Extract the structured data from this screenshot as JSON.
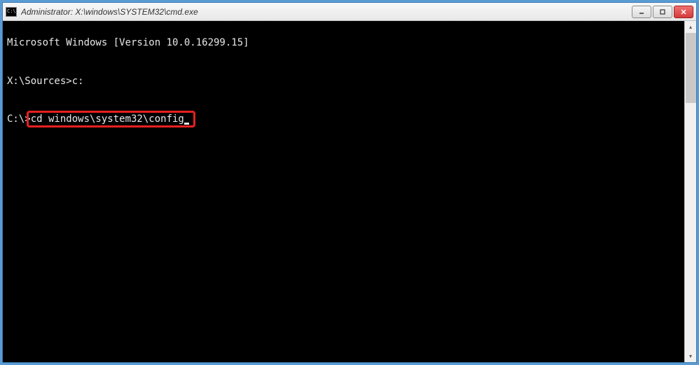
{
  "window": {
    "title": "Administrator: X:\\windows\\SYSTEM32\\cmd.exe",
    "icon_label": "C:\\"
  },
  "terminal": {
    "line1": "Microsoft Windows [Version 10.0.16299.15]",
    "line2": "",
    "line3_prompt": "X:\\Sources>",
    "line3_cmd": "c:",
    "line4": "",
    "line5_prompt": "C:\\>",
    "line5_cmd": "cd windows\\system32\\config"
  },
  "highlight": {
    "target": "line5_cmd"
  }
}
